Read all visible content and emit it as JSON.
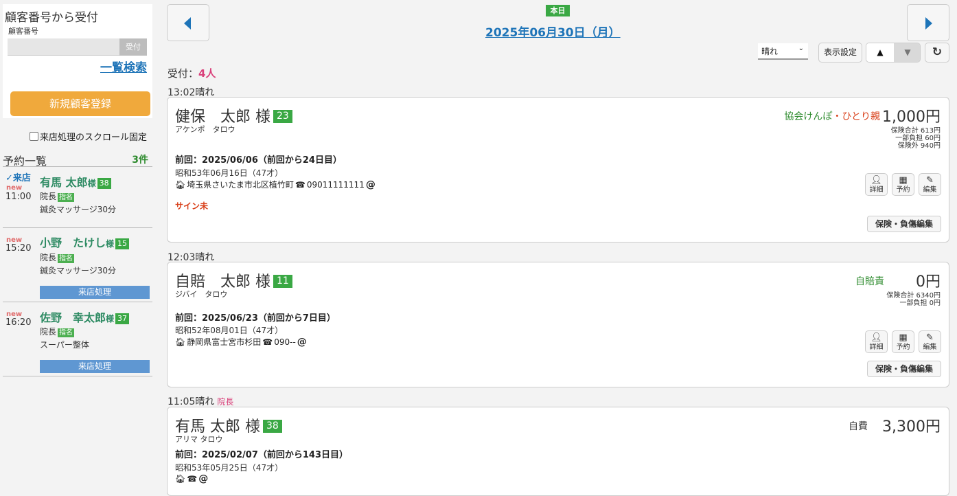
{
  "lookup": {
    "title": "顧客番号から受付",
    "label": "顧客番号",
    "input_value": "",
    "button": "受付",
    "list_search": "一覧検索",
    "new_customer": "新規顧客登録",
    "scroll_fix": "来店処理のスクロール固定"
  },
  "reservations": {
    "title": "予約一覧",
    "count": "3件",
    "items": [
      {
        "visited": "✓来店",
        "new": "new",
        "time": "11:00",
        "name": "有馬 太郎",
        "sama": "様",
        "num": "38",
        "staff": "院長",
        "shimei": "指名",
        "menu": "鍼灸マッサージ30分",
        "button": ""
      },
      {
        "visited": "",
        "new": "new",
        "time": "15:20",
        "name": "小野　たけし",
        "sama": "様",
        "num": "15",
        "staff": "院長",
        "shimei": "指名",
        "menu": "鍼灸マッサージ30分",
        "button": "来店処理"
      },
      {
        "visited": "",
        "new": "new",
        "time": "16:20",
        "name": "佐野　幸太郎",
        "sama": "様",
        "num": "37",
        "staff": "院長",
        "shimei": "指名",
        "menu": "スーパー整体",
        "button": "来店処理"
      }
    ]
  },
  "header": {
    "today": "本日",
    "date": "2025年06月30日（月）",
    "weather": "晴れ",
    "display_settings": "表示設定",
    "sort_up": "▲",
    "sort_down": "▼",
    "refresh": "↻"
  },
  "accepted": {
    "label": "受付：",
    "count": "4人"
  },
  "visits": [
    {
      "slot": "13:02晴れ",
      "role": "",
      "name": "健保　太郎 様",
      "num": "23",
      "kana": "アケンポ　タロウ",
      "insurance": "協会けんぽ",
      "insurance_sep": "・",
      "insurance_sub": "ひとり親",
      "price": "1,000円",
      "breakdown": [
        "保険合計 613円",
        "一部負担 60円",
        "保険外 940円"
      ],
      "last": "前回：2025/06/06（前回から24日目）",
      "dob": "昭和53年06月16日（47才）",
      "address": "埼玉県さいたま市北区植竹町",
      "phone": "09011111111",
      "sign": "サイン未",
      "buttons": [
        "詳細",
        "予約",
        "編集"
      ],
      "edit": "保険・負傷編集"
    },
    {
      "slot": "12:03晴れ",
      "role": "",
      "name": "自賠　太郎 様",
      "num": "11",
      "kana": "ジバイ　タロウ",
      "insurance": "自賠責",
      "insurance_sep": "",
      "insurance_sub": "",
      "price": "0円",
      "breakdown": [
        "保険合計 6340円",
        "一部負担 0円"
      ],
      "last": "前回：2025/06/23（前回から7日目）",
      "dob": "昭和52年08月01日（47才）",
      "address": "静岡県富士宮市杉田",
      "phone": "090--",
      "sign": "",
      "buttons": [
        "詳細",
        "予約",
        "編集"
      ],
      "edit": "保険・負傷編集"
    },
    {
      "slot": "11:05晴れ",
      "role": "院長",
      "name": "有馬 太郎 様",
      "num": "38",
      "kana": "アリマ タロウ",
      "insurance": "自費",
      "insurance_sep": "",
      "insurance_sub": "",
      "price": "3,300円",
      "breakdown": [],
      "last": "前回：2025/02/07（前回から143日目）",
      "dob": "昭和53年05月25日（47才）",
      "address": "",
      "phone": "",
      "sign": "",
      "buttons": [],
      "edit": ""
    }
  ],
  "colors": {
    "accent_blue": "#1e74b8",
    "orange": "#f0a93c",
    "green_badge": "#3aa844",
    "pink": "#d9407a",
    "sign_red": "#d9401a"
  }
}
